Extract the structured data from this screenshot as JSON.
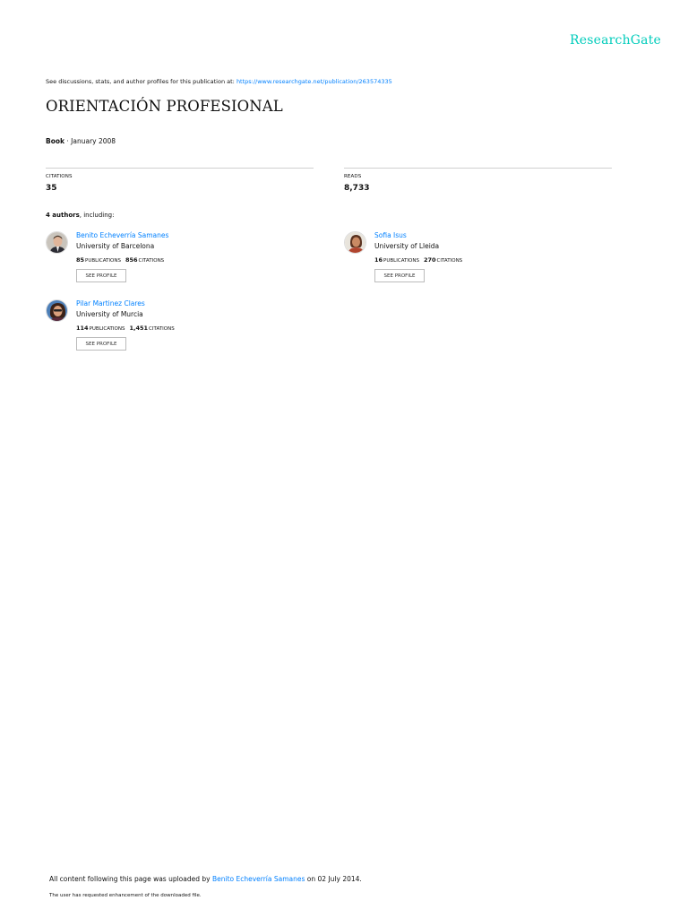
{
  "header": {
    "logo_text": "ResearchGate",
    "brand_color": "#00ccbb"
  },
  "discussion": {
    "prefix": "See discussions, stats, and author profiles for this publication at: ",
    "url": "https://www.researchgate.net/publication/263574335"
  },
  "publication": {
    "title": "ORIENTACIÓN PROFESIONAL",
    "type": "Book",
    "date": " · January 2008"
  },
  "stats": {
    "citations_label": "Citations",
    "citations_value": "35",
    "reads_label": "Reads",
    "reads_value": "8,733"
  },
  "authors_summary": {
    "count": "4 authors",
    "suffix": ", including:"
  },
  "authors": [
    {
      "name": "Benito Echeverría Samanes",
      "institution": "University of Barcelona",
      "publications": "85",
      "publications_label": "publications",
      "citations": "856",
      "citations_label": "citations",
      "button": "See profile"
    },
    {
      "name": "Sofia Isus",
      "institution": "University of Lleida",
      "publications": "16",
      "publications_label": "publications",
      "citations": "270",
      "citations_label": "citations",
      "button": "See profile"
    },
    {
      "name": "Pilar Martinez Clares",
      "institution": "University of Murcia",
      "publications": "114",
      "publications_label": "publications",
      "citations": "1,451",
      "citations_label": "citations",
      "button": "See profile"
    }
  ],
  "footer": {
    "upload_prefix": "All content following this page was uploaded by ",
    "uploader": "Benito Echeverría Samanes",
    "upload_suffix": " on 02 July 2014.",
    "note": "The user has requested enhancement of the downloaded file."
  },
  "colors": {
    "link": "#0080ff",
    "rule": "#cfcfcf"
  }
}
